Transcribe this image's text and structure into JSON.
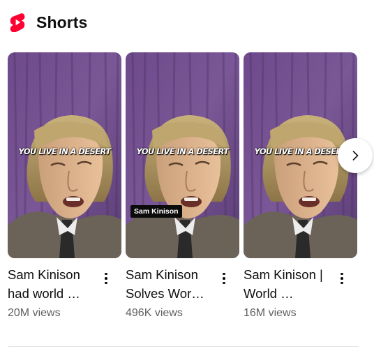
{
  "section": {
    "title": "Shorts",
    "logo_icon": "youtube-shorts-icon",
    "brand_color": "#ff0033"
  },
  "shorts": [
    {
      "title": "Sam Kinison had world …",
      "views": "20M views",
      "caption": "YOU LIVE IN A DESERT",
      "name_tag": ""
    },
    {
      "title": "Sam Kinison Solves Wor…",
      "views": "496K views",
      "caption": "YOU LIVE IN A DESERT",
      "name_tag": "Sam Kinison"
    },
    {
      "title": "Sam Kinison | World …",
      "views": "16M views",
      "caption": "YOU LIVE IN A DESERT",
      "name_tag": ""
    }
  ],
  "controls": {
    "more_icon": "more-vert-icon",
    "next_icon": "chevron-right-icon"
  }
}
